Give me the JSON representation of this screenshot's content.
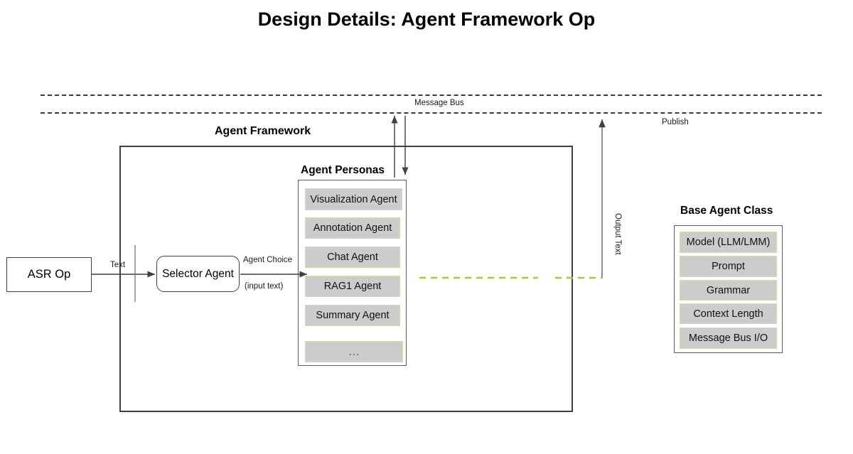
{
  "page": {
    "title": "Design Details: Agent Framework Op",
    "background_color": "#ffffff"
  },
  "colors": {
    "chip_fill": "#cccccc",
    "chip_border": "#d3dcb0",
    "line_dark": "#3f3f44",
    "green_dashed": "#9acd32",
    "text": "#000000"
  },
  "message_bus": {
    "label": "Message Bus",
    "publish_label": "Publish"
  },
  "agent_framework": {
    "title": "Agent Framework",
    "personas": {
      "title": "Agent Personas",
      "items": [
        {
          "label": "Visualization Agent"
        },
        {
          "label": "Annotation Agent"
        },
        {
          "label": "Chat Agent"
        },
        {
          "label": "RAG1 Agent"
        },
        {
          "label": "Summary Agent"
        },
        {
          "label": "…"
        }
      ]
    }
  },
  "base_agent_class": {
    "title": "Base Agent Class",
    "items": [
      {
        "label": "Model (LLM/LMM)"
      },
      {
        "label": "Prompt"
      },
      {
        "label": "Grammar"
      },
      {
        "label": "Context Length"
      },
      {
        "label": "Message Bus I/O"
      }
    ]
  },
  "nodes": {
    "asr_op": "ASR Op",
    "selector_agent": "Selector Agent"
  },
  "edges": {
    "text": "Text",
    "agent_choice": "Agent Choice",
    "input_text": "(input text)",
    "output_text": "Output Text"
  }
}
